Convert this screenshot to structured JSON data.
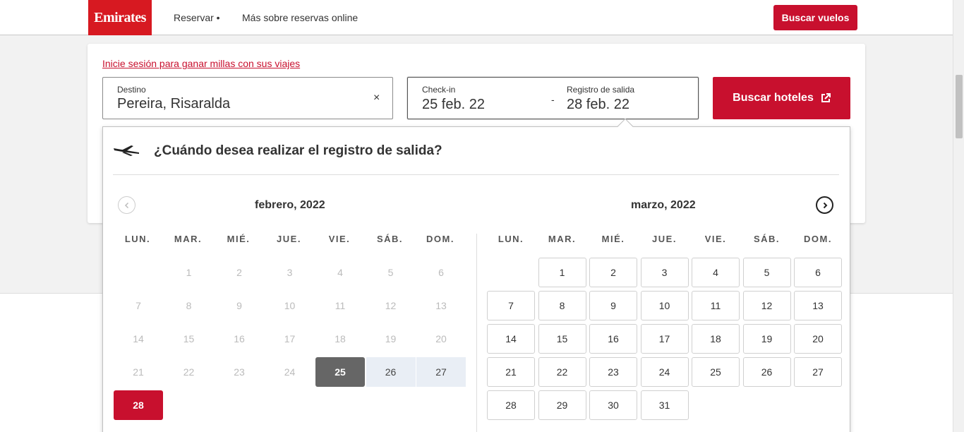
{
  "header": {
    "logo": "Emirates",
    "nav": [
      "Reservar •",
      "Más sobre reservas online"
    ],
    "search_flights": "Buscar vuelos"
  },
  "search": {
    "signin_link": "Inicie sesión para ganar millas con sus viajes",
    "destination_label": "Destino",
    "destination_value": "Pereira, Risaralda",
    "clear": "×",
    "checkin_label": "Check-in",
    "checkin_value": "25 feb. 22",
    "separator": "-",
    "checkout_label": "Registro de salida",
    "checkout_value": "28 feb. 22",
    "search_hotels": "Buscar hoteles"
  },
  "calendar": {
    "question": "¿Cuándo desea realizar el registro de salida?",
    "weekdays": [
      "LUN.",
      "MAR.",
      "MIÉ.",
      "JUE.",
      "VIE.",
      "SÁB.",
      "DOM."
    ],
    "months": [
      {
        "title": "febrero, 2022",
        "days": [
          [
            "",
            "1",
            "2",
            "3",
            "4",
            "5",
            "6"
          ],
          [
            "7",
            "8",
            "9",
            "10",
            "11",
            "12",
            "13"
          ],
          [
            "14",
            "15",
            "16",
            "17",
            "18",
            "19",
            "20"
          ],
          [
            "21",
            "22",
            "23",
            "24",
            "25",
            "26",
            "27"
          ],
          [
            "28",
            "",
            "",
            "",
            "",
            "",
            ""
          ]
        ]
      },
      {
        "title": "marzo, 2022",
        "days": [
          [
            "",
            "1",
            "2",
            "3",
            "4",
            "5",
            "6"
          ],
          [
            "7",
            "8",
            "9",
            "10",
            "11",
            "12",
            "13"
          ],
          [
            "14",
            "15",
            "16",
            "17",
            "18",
            "19",
            "20"
          ],
          [
            "21",
            "22",
            "23",
            "24",
            "25",
            "26",
            "27"
          ],
          [
            "28",
            "29",
            "30",
            "31",
            "",
            "",
            ""
          ]
        ]
      }
    ],
    "checkin_day": "25",
    "checkout_day": "28",
    "colors": {
      "accent": "#c8102e",
      "checkin": "#666666",
      "range": "#e9eef5"
    }
  }
}
